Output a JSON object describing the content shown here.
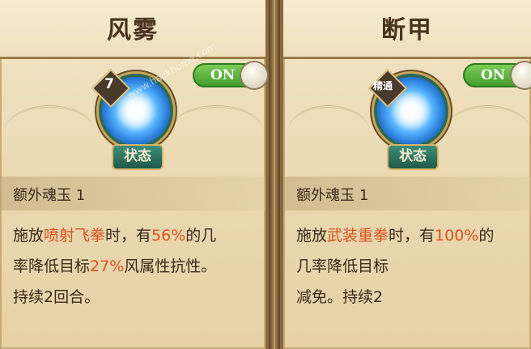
{
  "cards": [
    {
      "title": "风雾",
      "toggle": "ON",
      "rank": "7",
      "badge": "状态",
      "row_header": "额外魂玉 1",
      "desc": {
        "p1": "施放",
        "h1": "喷射飞拳",
        "p2": "时，有",
        "h2": "56%",
        "p3": "的几",
        "p4": "率降低目标",
        "h3": "27%",
        "p5": "风属性抗性。",
        "p6": "持续2回合。"
      }
    },
    {
      "title": "断甲",
      "toggle": "ON",
      "rank": "精通",
      "badge": "状态",
      "row_header": "额外魂玉 1",
      "desc": {
        "p1": "施放",
        "h1": "武装重拳",
        "p2": "时，有",
        "h2": "100%",
        "p3": "的",
        "p4": "几率降低目标",
        "p6": "减免。持续2"
      }
    }
  ],
  "watermark": "www.hackhome.com",
  "colors": {
    "highlight": "#d9541e",
    "toggle_on": "#3f9a2a"
  }
}
